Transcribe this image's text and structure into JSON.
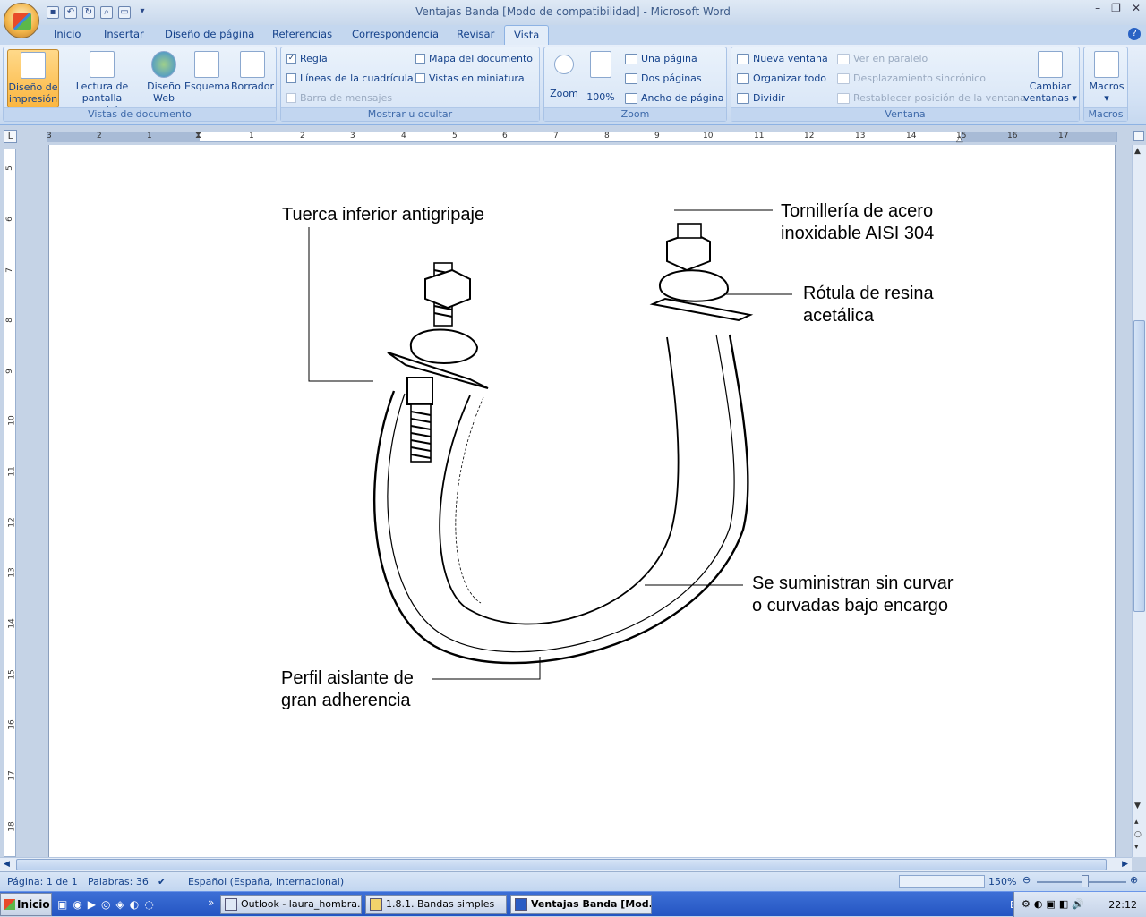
{
  "window": {
    "title": "Ventajas Banda [Modo de compatibilidad] - Microsoft Word"
  },
  "tabs": [
    "Inicio",
    "Insertar",
    "Diseño de página",
    "Referencias",
    "Correspondencia",
    "Revisar",
    "Vista"
  ],
  "ribbon": {
    "vistas": {
      "label": "Vistas de documento",
      "b1": "Diseño de",
      "b1b": "impresión",
      "b2": "Lectura de",
      "b2b": "pantalla completa",
      "b3": "Diseño",
      "b3b": "Web",
      "b4": "Esquema",
      "b5": "Borrador"
    },
    "mostrar": {
      "label": "Mostrar u ocultar",
      "regla": "Regla",
      "lineas": "Líneas de la cuadrícula",
      "barra": "Barra de mensajes",
      "mapa": "Mapa del documento",
      "miniatura": "Vistas en miniatura"
    },
    "zoom": {
      "label": "Zoom",
      "zoom": "Zoom",
      "pct": "100%",
      "una": "Una página",
      "dos": "Dos páginas",
      "ancho": "Ancho de página"
    },
    "ventana": {
      "label": "Ventana",
      "nueva": "Nueva ventana",
      "organizar": "Organizar todo",
      "dividir": "Dividir",
      "paralelo": "Ver en paralelo",
      "desplaz": "Desplazamiento sincrónico",
      "restablecer": "Restablecer posición de la ventana",
      "cambiar": "Cambiar",
      "cambiarb": "ventanas"
    },
    "macros": {
      "label": "Macros",
      "btn": "Macros"
    }
  },
  "ruler": {
    "h": [
      "3",
      "2",
      "1",
      "1",
      "2",
      "3",
      "4",
      "5",
      "6",
      "7",
      "8",
      "9",
      "10",
      "11",
      "12",
      "13",
      "14",
      "15",
      "16",
      "17"
    ],
    "v": [
      "5",
      "6",
      "7",
      "8",
      "9",
      "10",
      "11",
      "12",
      "13",
      "14",
      "15",
      "16",
      "17",
      "18"
    ]
  },
  "figure": {
    "l1": "Tuerca inferior antigripaje",
    "l2a": "Tornillería de acero",
    "l2b": "inoxidable AISI 304",
    "l3a": "Rótula de resina",
    "l3b": "acetálica",
    "l4a": "Se suministran sin curvar",
    "l4b": "o curvadas bajo encargo",
    "l5a": "Perfil aislante de",
    "l5b": "gran adherencia"
  },
  "status": {
    "page": "Página: 1 de 1",
    "words": "Palabras: 36",
    "lang": "Español (España, internacional)",
    "zoom": "150%"
  },
  "taskbar": {
    "start": "Inicio",
    "t1": "Outlook - laura_hombra...",
    "t2": "1.8.1. Bandas simples",
    "t3": "Ventajas Banda [Mod...",
    "lang": "ES",
    "time": "22:12"
  }
}
